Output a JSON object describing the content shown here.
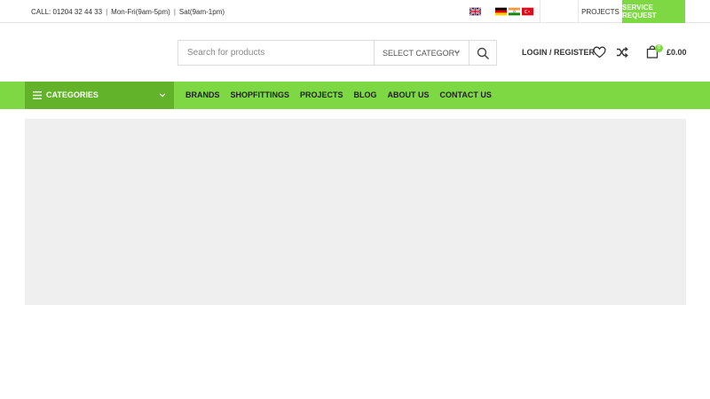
{
  "topbar": {
    "call": "CALL: 01204 32 44 33",
    "hours_weekday": "Mon-Fri(9am-5pm)",
    "hours_sat": "Sat(9am-1pm)",
    "separator": "|",
    "languages": [
      "English",
      "Deutsch",
      "Hindi",
      "Türkçe"
    ],
    "projects_link": "PROJECTS",
    "service_button": "SERVICE REQUEST"
  },
  "header": {
    "search": {
      "placeholder": "Search for products",
      "category_label": "SELECT CATEGORY"
    },
    "login_label": "LOGIN / REGISTER",
    "cart": {
      "count": "0",
      "total": "£0.00"
    }
  },
  "navbar": {
    "categories_label": "CATEGORIES",
    "items": [
      "BRANDS",
      "SHOPFITTINGS",
      "PROJECTS",
      "BLOG",
      "ABOUT US",
      "CONTACT US"
    ]
  },
  "icons": {
    "menu": "hamburger-icon",
    "chevron": "chevron-down-icon",
    "search": "search-icon",
    "wishlist": "heart-icon",
    "compare": "shuffle-icon",
    "cart": "shopping-bag-icon"
  },
  "colors": {
    "accent": "#7dd844",
    "accent_dark": "#62b32a",
    "placeholder_bg": "#efefef"
  }
}
